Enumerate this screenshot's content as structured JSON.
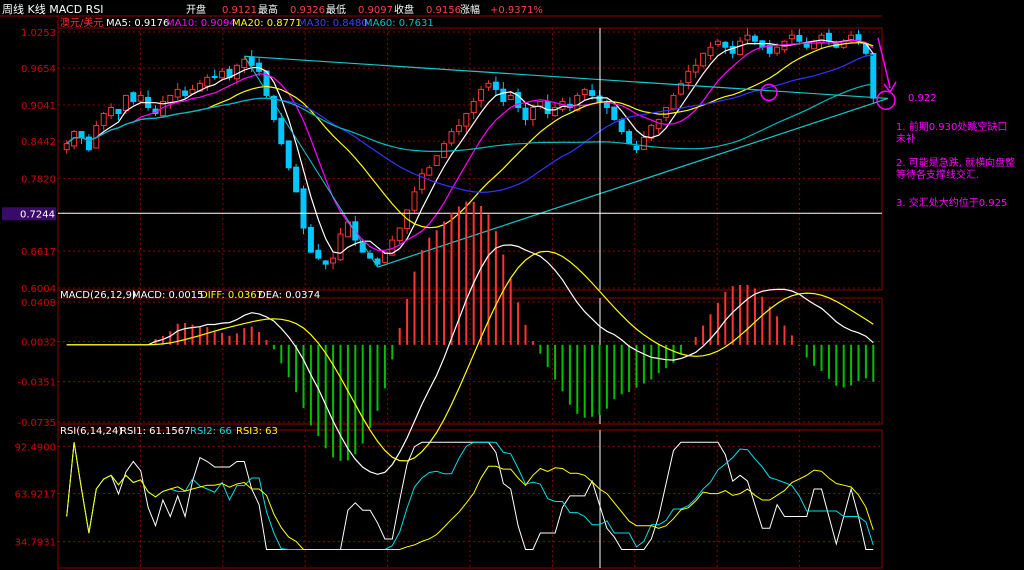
{
  "header": {
    "title": "周线 K线 MACD RSI",
    "open_label": "开盘",
    "open_value": "0.9121",
    "high_label": "最高",
    "high_value": "0.9326",
    "low_label": "最低",
    "low_value": "0.9097",
    "close_label": "收盘",
    "close_value": "0.9156",
    "change_label": "涨幅",
    "change_value": "+0.9371%"
  },
  "price_panel": {
    "symbol": "澳元/美元",
    "ma5": "MA5: 0.9176",
    "ma10": "MA10: 0.9094",
    "ma20": "MA20: 0.8771",
    "ma30": "MA30: 0.8480",
    "ma60": "MA60: 0.7631",
    "y_ticks": [
      "1.0253",
      "0.9654",
      "0.9041",
      "0.8442",
      "0.7820",
      "0.7244",
      "0.6617",
      "0.6004"
    ],
    "crosshair_value": "0.7244",
    "target_label": "0.922"
  },
  "macd_panel": {
    "title": "MACD(26,12,9)",
    "macd": "MACD: 0.0015",
    "diff": "DIFF: 0.0367",
    "dea": "DEA: 0.0374",
    "y_ticks": [
      "0.0408",
      "0.0032",
      "-0.0351",
      "-0.0735"
    ]
  },
  "rsi_panel": {
    "title": "RSI(6,14,24)",
    "rsi1": "RSI1: 61.1567",
    "rsi2": "RSI2: 66",
    "rsi3": "RSI3: 63",
    "y_ticks": [
      "92.4900",
      "63.9217",
      "34.7931"
    ]
  },
  "notes": {
    "n1": "1. 前期0.930处跳空缺口未补",
    "n2": "2. 可能是急跌, 就横向盘整等待各支撑线交汇.",
    "n3": "3. 交汇处大约位于0.925"
  },
  "colors": {
    "up": "#ff3333",
    "down": "#00c8ff",
    "grid": "#8b0000",
    "ma5": "#ffffff",
    "ma10": "#ff00ff",
    "ma20": "#ffff00",
    "ma30": "#3333ff",
    "ma60": "#00bcbc",
    "annotation": "#ff00ff"
  },
  "chart_data": {
    "type": "candlestick",
    "price_range": [
      0.6004,
      1.0253
    ],
    "macd_range": [
      -0.0735,
      0.0408
    ],
    "rsi_range": [
      34.7931,
      92.49
    ],
    "candle_count": 110,
    "close_path": [
      0.84,
      0.86,
      0.85,
      0.83,
      0.87,
      0.89,
      0.9,
      0.89,
      0.92,
      0.91,
      0.92,
      0.9,
      0.89,
      0.91,
      0.92,
      0.93,
      0.92,
      0.93,
      0.94,
      0.95,
      0.95,
      0.96,
      0.95,
      0.97,
      0.98,
      0.97,
      0.96,
      0.92,
      0.88,
      0.84,
      0.8,
      0.76,
      0.7,
      0.66,
      0.65,
      0.64,
      0.65,
      0.69,
      0.71,
      0.68,
      0.66,
      0.65,
      0.64,
      0.66,
      0.68,
      0.7,
      0.73,
      0.76,
      0.79,
      0.8,
      0.82,
      0.84,
      0.86,
      0.87,
      0.89,
      0.91,
      0.93,
      0.94,
      0.93,
      0.91,
      0.92,
      0.9,
      0.88,
      0.9,
      0.91,
      0.89,
      0.9,
      0.91,
      0.9,
      0.92,
      0.93,
      0.92,
      0.91,
      0.9,
      0.88,
      0.86,
      0.84,
      0.83,
      0.85,
      0.87,
      0.88,
      0.9,
      0.92,
      0.94,
      0.96,
      0.97,
      0.99,
      1.0,
      1.01,
      1.0,
      0.99,
      1.01,
      1.02,
      1.01,
      1.0,
      0.99,
      1.0,
      1.01,
      1.02,
      1.01,
      1.0,
      1.01,
      1.02,
      1.01,
      1.0,
      1.01,
      1.02,
      1.01,
      0.99,
      0.9156
    ],
    "ma_series": [
      "MA5",
      "MA10",
      "MA20",
      "MA30",
      "MA60"
    ]
  }
}
